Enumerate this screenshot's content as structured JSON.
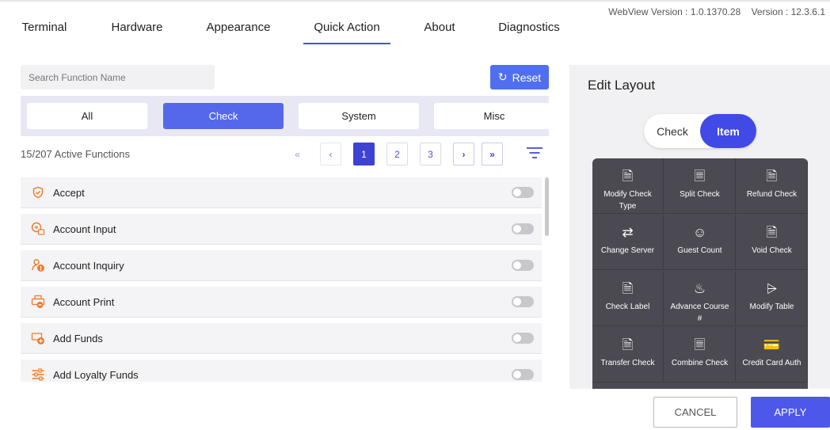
{
  "header": {
    "webview_version": "WebView Version : 1.0.1370.28",
    "version": "Version : 12.3.6.1"
  },
  "tabs": [
    {
      "label": "Terminal",
      "active": false
    },
    {
      "label": "Hardware",
      "active": false
    },
    {
      "label": "Appearance",
      "active": false
    },
    {
      "label": "Quick Action",
      "active": true
    },
    {
      "label": "About",
      "active": false
    },
    {
      "label": "Diagnostics",
      "active": false
    }
  ],
  "search": {
    "placeholder": "Search Function Name",
    "value": ""
  },
  "reset": {
    "label": "Reset",
    "icon": "refresh-icon"
  },
  "filters": [
    {
      "label": "All",
      "active": false
    },
    {
      "label": "Check",
      "active": true
    },
    {
      "label": "System",
      "active": false
    },
    {
      "label": "Misc",
      "active": false
    }
  ],
  "active_count": "15/207 Active Functions",
  "pagination": {
    "first": "«",
    "prev": "‹",
    "pages": [
      "1",
      "2",
      "3"
    ],
    "current_page": 1,
    "next": "›",
    "last": "»"
  },
  "functions": [
    {
      "label": "Accept",
      "icon": "shield-check-icon",
      "enabled": false
    },
    {
      "label": "Account Input",
      "icon": "account-input-icon",
      "enabled": false
    },
    {
      "label": "Account Inquiry",
      "icon": "account-inquiry-icon",
      "enabled": false
    },
    {
      "label": "Account Print",
      "icon": "printer-icon",
      "enabled": false
    },
    {
      "label": "Add Funds",
      "icon": "add-funds-icon",
      "enabled": false
    },
    {
      "label": "Add Loyalty Funds",
      "icon": "sliders-icon",
      "enabled": false
    }
  ],
  "edit_layout": {
    "title": "Edit Layout",
    "modes": [
      {
        "label": "Check",
        "active": false
      },
      {
        "label": "Item",
        "active": true
      }
    ],
    "items": [
      {
        "label": "Modify Check Type",
        "icon": "modify-check-icon"
      },
      {
        "label": "Split Check",
        "icon": "split-check-icon"
      },
      {
        "label": "Refund Check",
        "icon": "refund-check-icon"
      },
      {
        "label": "Change Server",
        "icon": "change-server-icon"
      },
      {
        "label": "Guest Count",
        "icon": "guest-count-icon"
      },
      {
        "label": "Void Check",
        "icon": "void-check-icon"
      },
      {
        "label": "Check Label",
        "icon": "check-label-icon"
      },
      {
        "label": "Advance Course #",
        "icon": "advance-course-icon"
      },
      {
        "label": "Modify Table",
        "icon": "modify-table-icon"
      },
      {
        "label": "Transfer Check",
        "icon": "transfer-check-icon"
      },
      {
        "label": "Combine Check",
        "icon": "combine-check-icon"
      },
      {
        "label": "Credit Card Auth",
        "icon": "credit-card-auth-icon"
      }
    ]
  },
  "footer": {
    "cancel": "CANCEL",
    "apply": "APPLY"
  },
  "colors": {
    "accent": "#4b4fe0",
    "icon_orange": "#f07a2a",
    "grid_bg": "#4b4a52"
  }
}
